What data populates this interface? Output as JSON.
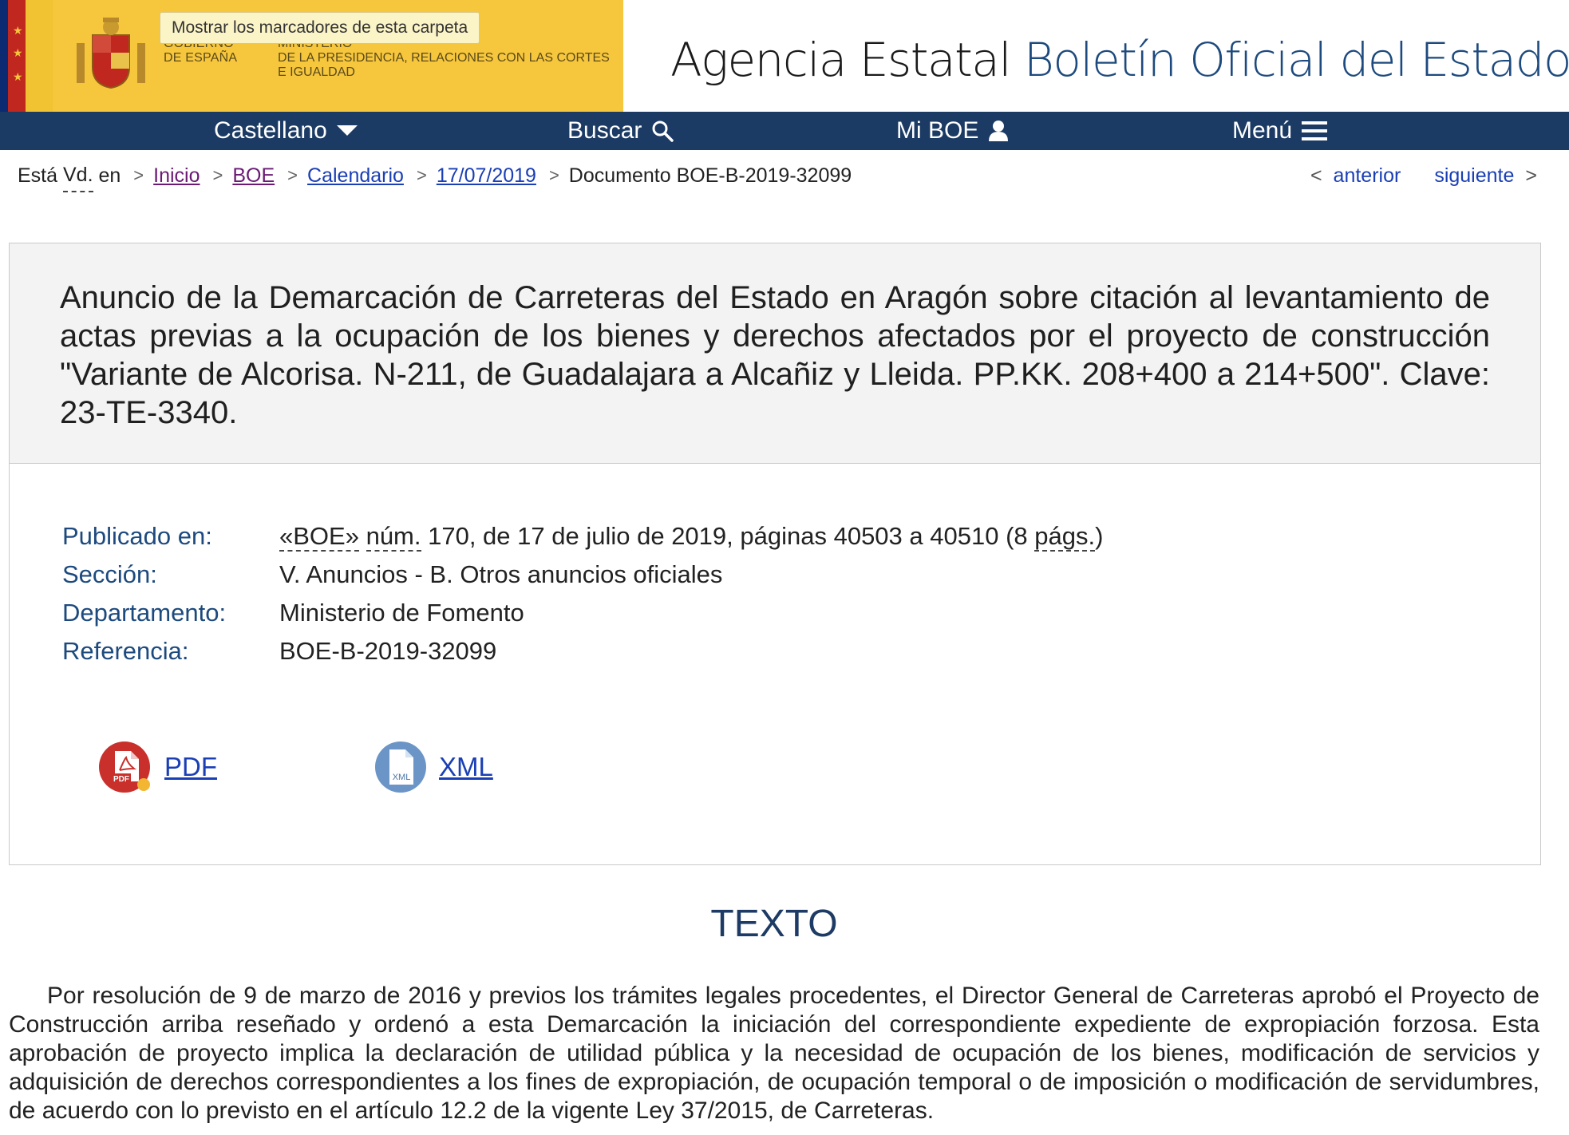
{
  "header": {
    "gov_label_1": "Gobierno",
    "gov_label_2": "de España",
    "ministry_label_1": "Ministerio",
    "ministry_label_2": "de la Presidencia, Relaciones con las Cortes",
    "ministry_label_3": "e Igualdad",
    "bookmark_tooltip": "Mostrar los marcadores de esta carpeta",
    "title_prefix": "Agencia Estatal",
    "title_accent": "Boletín Oficial del Estado"
  },
  "nav": {
    "language": "Castellano",
    "search": "Buscar",
    "my_boe": "Mi BOE",
    "menu": "Menú"
  },
  "breadcrumb": {
    "prefix_1": "Está",
    "prefix_abbr": "Vd.",
    "prefix_2": "en",
    "items": [
      "Inicio",
      "BOE",
      "Calendario",
      "17/07/2019"
    ],
    "current": "Documento BOE-B-2019-32099"
  },
  "pager": {
    "prev": "anterior",
    "next": "siguiente"
  },
  "document": {
    "title": "Anuncio de la Demarcación de Carreteras del Estado en Aragón sobre citación al levantamiento de actas previas a la ocupación de los bienes y derechos afectados por el proyecto de construcción \"Variante de Alcorisa. N-211, de Guadalajara a Alcañiz y Lleida. PP.KK. 208+400 a 214+500\". Clave: 23-TE-3340.",
    "published_label": "Publicado en:",
    "published_boe": "«BOE»",
    "published_num_abbr": "núm.",
    "published_rest": " 170, de 17 de julio de 2019, páginas 40503 a 40510 (8 ",
    "published_pages_abbr": "págs.",
    "published_close": ")",
    "section_label": "Sección:",
    "section_value": "V. Anuncios - B. Otros anuncios oficiales",
    "department_label": "Departamento:",
    "department_value": "Ministerio de Fomento",
    "reference_label": "Referencia:",
    "reference_value": "BOE-B-2019-32099",
    "pdf_label": "PDF",
    "xml_label": "XML",
    "pdf_icon_text": "PDF",
    "xml_icon_text": "XML"
  },
  "texto": {
    "heading": "TEXTO",
    "paragraph": "Por resolución de 9 de marzo de 2016 y previos los trámites legales procedentes, el Director General de Carreteras aprobó el Proyecto de Construcción arriba reseñado y ordenó a esta Demarcación la iniciación del correspondiente expediente de expropiación forzosa. Esta aprobación de proyecto implica la declaración de utilidad pública y la necesidad de ocupación de los bienes, modificación de servicios y adquisición de derechos correspondientes a los fines de expropiación, de ocupación temporal o de imposición o modificación de servidumbres, de acuerdo con lo previsto en el artículo 12.2 de la vigente Ley 37/2015, de Carreteras."
  },
  "colors": {
    "navbar": "#1b3a64",
    "gov_yellow": "#f6c63c",
    "title_accent": "#1d4a7e",
    "link": "#1a3fb5",
    "visited_link": "#6a1a75"
  }
}
